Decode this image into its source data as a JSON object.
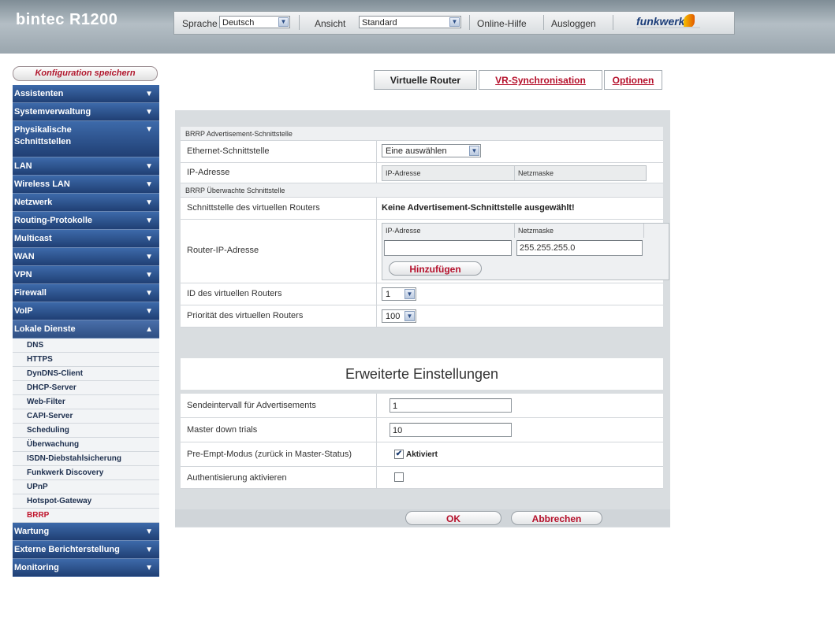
{
  "header": {
    "logo": "bintec R1200",
    "language_label": "Sprache",
    "language_value": "Deutsch",
    "view_label": "Ansicht",
    "view_value": "Standard",
    "help_label": "Online-Hilfe",
    "logout_label": "Ausloggen",
    "brand": "funkwerk"
  },
  "sidebar": {
    "save_label": "Konfiguration speichern",
    "items": [
      {
        "label": "Assistenten"
      },
      {
        "label": "Systemverwaltung"
      },
      {
        "label": "Physikalische Schnittstellen"
      },
      {
        "label": "LAN"
      },
      {
        "label": "Wireless LAN"
      },
      {
        "label": "Netzwerk"
      },
      {
        "label": "Routing-Protokolle"
      },
      {
        "label": "Multicast"
      },
      {
        "label": "WAN"
      },
      {
        "label": "VPN"
      },
      {
        "label": "Firewall"
      },
      {
        "label": "VoIP"
      },
      {
        "label": "Lokale Dienste"
      }
    ],
    "subitems": [
      "DNS",
      "HTTPS",
      "DynDNS-Client",
      "DHCP-Server",
      "Web-Filter",
      "CAPI-Server",
      "Scheduling",
      "Überwachung",
      "ISDN-Diebstahlsicherung",
      "Funkwerk Discovery",
      "UPnP",
      "Hotspot-Gateway",
      "BRRP"
    ],
    "items_after": [
      {
        "label": "Wartung"
      },
      {
        "label": "Externe Berichterstellung"
      },
      {
        "label": "Monitoring"
      }
    ]
  },
  "tabs": [
    "Virtuelle Router",
    "VR-Synchronisation",
    "Optionen"
  ],
  "form": {
    "section1_header": "BRRP Advertisement-Schnittstelle",
    "eth_label": "Ethernet-Schnittstelle",
    "eth_value": "Eine auswählen",
    "ip_label": "IP-Adresse",
    "ip_col1": "IP-Adresse",
    "ip_col2": "Netzmaske",
    "section2_header": "BRRP Überwachte Schnittstelle",
    "vr_if_label": "Schnittstelle des virtuellen Routers",
    "vr_if_value": "Keine Advertisement-Schnittstelle ausgewählt!",
    "router_ip_label": "Router-IP-Adresse",
    "router_ip_col1": "IP-Adresse",
    "router_ip_col2": "Netzmaske",
    "router_ip_value": "",
    "router_mask_value": "255.255.255.0",
    "add_button": "Hinzufügen",
    "vr_id_label": "ID des virtuellen Routers",
    "vr_id_value": "1",
    "priority_label": "Priorität des virtuellen Routers",
    "priority_value": "100",
    "advanced_title": "Erweiterte Einstellungen",
    "send_interval_label": "Sendeintervall für Advertisements",
    "send_interval_value": "1",
    "master_down_label": "Master down trials",
    "master_down_value": "10",
    "preempt_label": "Pre-Empt-Modus (zurück in Master-Status)",
    "preempt_value": "Aktiviert",
    "preempt_checked": true,
    "auth_label": "Authentisierung aktivieren",
    "auth_checked": false,
    "ok_button": "OK",
    "cancel_button": "Abbrechen"
  },
  "icons": {
    "chevron": "chevron-down-icon",
    "chevron_open": "chevron-up-icon",
    "checkmark": "check-icon"
  },
  "colors": {
    "nav_blue": "#2a4d86",
    "accent_red": "#b5102b",
    "header_grey": "#9aa6ae"
  }
}
